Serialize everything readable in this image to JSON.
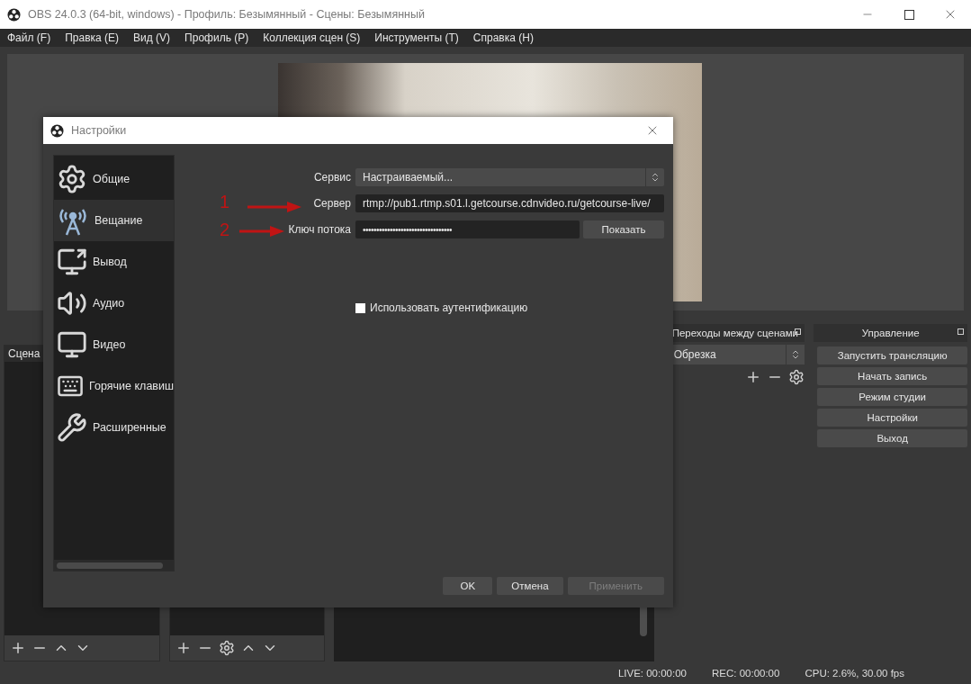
{
  "window": {
    "title": "OBS 24.0.3 (64-bit, windows) - Профиль: Безымянный - Сцены: Безымянный"
  },
  "menu": [
    "Файл (F)",
    "Правка (E)",
    "Вид (V)",
    "Профиль (P)",
    "Коллекция сцен (S)",
    "Инструменты (T)",
    "Справка (H)"
  ],
  "docks": {
    "scenes": {
      "title": "Сцена"
    },
    "transitions": {
      "title": "Переходы между сценами",
      "value": "Обрезка"
    },
    "controls": {
      "title": "Управление",
      "buttons": [
        "Запустить трансляцию",
        "Начать запись",
        "Режим студии",
        "Настройки",
        "Выход"
      ]
    }
  },
  "status_bar": {
    "live": "LIVE: 00:00:00",
    "rec": "REC: 00:00:00",
    "cpu": "CPU: 2.6%, 30.00 fps"
  },
  "settings_dialog": {
    "title": "Настройки",
    "sidebar": [
      {
        "label": "Общие",
        "selected": false
      },
      {
        "label": "Вещание",
        "selected": true
      },
      {
        "label": "Вывод",
        "selected": false
      },
      {
        "label": "Аудио",
        "selected": false
      },
      {
        "label": "Видео",
        "selected": false
      },
      {
        "label": "Горячие клавиш",
        "selected": false
      },
      {
        "label": "Расширенные",
        "selected": false
      }
    ],
    "service": {
      "label": "Сервис",
      "value": "Настраиваемый..."
    },
    "server": {
      "label": "Сервер",
      "value": "rtmp://pub1.rtmp.s01.l.getcourse.cdnvideo.ru/getcourse-live/"
    },
    "stream_key": {
      "label": "Ключ потока",
      "value": "•••••••••••••••••••••••••••••••••",
      "button": "Показать"
    },
    "auth": {
      "label": "Использовать аутентификацию",
      "checked": false
    },
    "annotations": [
      "1",
      "2"
    ],
    "buttons": [
      {
        "label": "OK",
        "disabled": false
      },
      {
        "label": "Отмена",
        "disabled": false
      },
      {
        "label": "Применить",
        "disabled": true
      }
    ]
  }
}
